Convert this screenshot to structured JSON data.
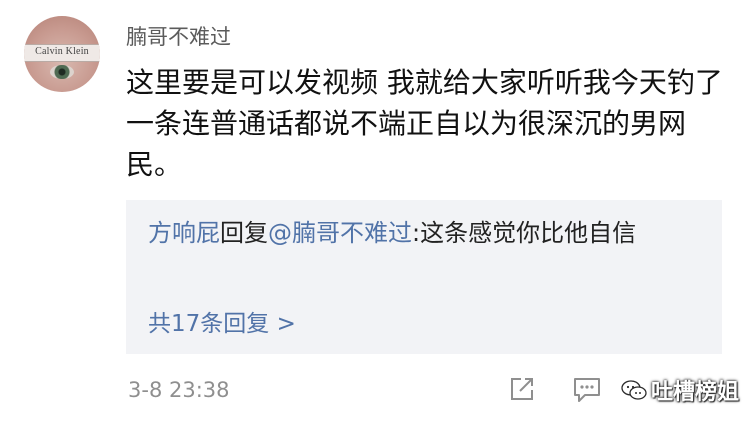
{
  "post": {
    "avatar_text": "Calvin Klein",
    "username": "腩哥不难过",
    "content": "这里要是可以发视频 我就给大家听听我今天钓了一条连普通话都说不端正自以为很深沉的男网民。",
    "timestamp": "3-8 23:38"
  },
  "reply": {
    "author": "方响屁",
    "verb": "回复",
    "mention": "@腩哥不难过",
    "separator": ":",
    "text": "这条感觉你比他自信",
    "total_label": "共17条回复 >"
  },
  "actions": {
    "share_icon": "share-icon",
    "comment_icon": "comment-icon"
  },
  "watermark": {
    "text": "吐槽榜姐"
  },
  "colors": {
    "link": "#5173a8",
    "reply_bg": "#f2f3f6",
    "meta": "#8f8f8f"
  }
}
